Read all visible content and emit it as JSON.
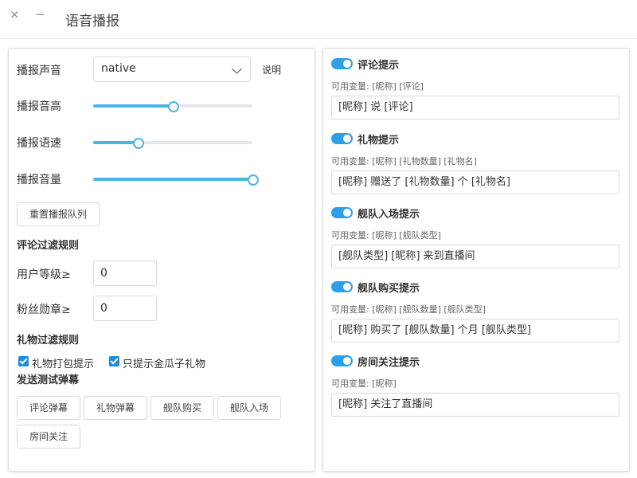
{
  "window": {
    "title": "语音播报",
    "close_glyph": "×",
    "min_glyph": "−"
  },
  "settings": {
    "voice_label": "播报声音",
    "voice_value": "native",
    "help_label": "说明",
    "pitch_label": "播报音高",
    "pitch_fraction": 0.5,
    "speed_label": "播报语速",
    "speed_fraction": 0.28,
    "volume_label": "播报音量",
    "volume_fraction": 1.0,
    "reset_queue_label": "重置播报队列"
  },
  "comment_filter": {
    "title": "评论过滤规则",
    "user_level_label": "用户等级≥",
    "user_level_value": "0",
    "fan_medal_label": "粉丝勋章≥",
    "fan_medal_value": "0"
  },
  "gift_filter": {
    "title": "礼物过滤规则",
    "options": [
      {
        "label": "礼物打包提示",
        "checked": true
      },
      {
        "label": "只提示金瓜子礼物",
        "checked": true
      }
    ]
  },
  "test": {
    "title": "发送测试弹幕",
    "buttons": [
      "评论弹幕",
      "礼物弹幕",
      "舰队购买",
      "舰队入场",
      "房间关注"
    ]
  },
  "prompts": [
    {
      "title": "评论提示",
      "enabled": true,
      "vars": "可用变量: [昵称] [评论]",
      "template": "[昵称] 说 [评论]"
    },
    {
      "title": "礼物提示",
      "enabled": true,
      "vars": "可用变量: [昵称] [礼物数量] [礼物名]",
      "template": "[昵称] 赠送了 [礼物数量] 个 [礼物名]"
    },
    {
      "title": "舰队入场提示",
      "enabled": true,
      "vars": "可用变量: [昵称] [舰队类型]",
      "template": "[舰队类型] [昵称] 来到直播间"
    },
    {
      "title": "舰队购买提示",
      "enabled": true,
      "vars": "可用变量: [昵称] [舰队数量] [舰队类型]",
      "template": "[昵称] 购买了 [舰队数量] 个月 [舰队类型]"
    },
    {
      "title": "房间关注提示",
      "enabled": true,
      "vars": "可用变量: [昵称]",
      "template": "[昵称] 关注了直播间"
    }
  ],
  "colors": {
    "accent": "#4bb4e6",
    "toggle_on": "#2d9ee8",
    "checkbox": "#1f8ce0"
  }
}
